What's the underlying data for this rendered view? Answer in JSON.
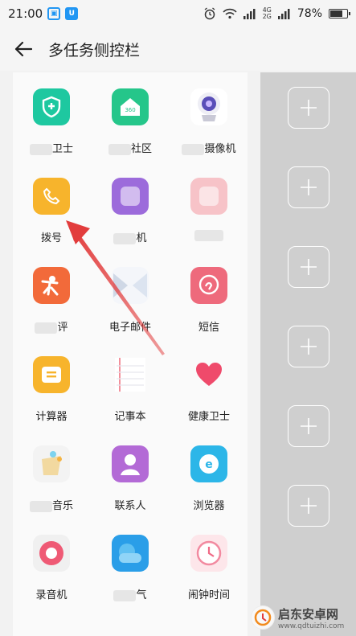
{
  "status_bar": {
    "time": "21:00",
    "net_top": "4G",
    "net_bottom": "2G",
    "battery_text": "78%",
    "battery_level": 0.78
  },
  "header": {
    "title": "多任务侧控栏"
  },
  "apps": [
    {
      "label_parts": [
        "",
        "卫士"
      ],
      "color": "#1ec8a0",
      "icon": "shield-plus-icon"
    },
    {
      "label_parts": [
        "",
        "社区"
      ],
      "color": "#25c68a",
      "icon": "house-360-icon"
    },
    {
      "label_parts": [
        "",
        "摄像机"
      ],
      "color": "#ffffff",
      "icon": "camera-icon"
    },
    {
      "label_parts": [
        "拨号",
        ""
      ],
      "color": "#f7b42c",
      "icon": "phone-icon"
    },
    {
      "label_parts": [
        "",
        "机"
      ],
      "color": "#9c6bdb",
      "icon": "app-icon"
    },
    {
      "label_parts": [
        "",
        ""
      ],
      "color": "#f7c3c8",
      "icon": "app-icon"
    },
    {
      "label_parts": [
        "",
        "评"
      ],
      "color": "#f26a3a",
      "icon": "person-icon"
    },
    {
      "label_parts": [
        "电子邮件",
        ""
      ],
      "color": "#f4f6fa",
      "icon": "mail-icon"
    },
    {
      "label_parts": [
        "短信",
        ""
      ],
      "color": "#ee6a7c",
      "icon": "message-icon"
    },
    {
      "label_parts": [
        "计算器",
        ""
      ],
      "color": "#f7b42c",
      "icon": "calculator-icon"
    },
    {
      "label_parts": [
        "记事本",
        ""
      ],
      "color": "#fafafa",
      "icon": "notepad-icon"
    },
    {
      "label_parts": [
        "健康卫士",
        ""
      ],
      "color": "#fafafa",
      "icon": "heart-icon"
    },
    {
      "label_parts": [
        "",
        "音乐"
      ],
      "color": "#f3f3f3",
      "icon": "music-icon"
    },
    {
      "label_parts": [
        "联系人",
        ""
      ],
      "color": "#b36ad6",
      "icon": "contacts-icon"
    },
    {
      "label_parts": [
        "浏览器",
        ""
      ],
      "color": "#2cb6e8",
      "icon": "browser-icon"
    },
    {
      "label_parts": [
        "录音机",
        ""
      ],
      "color": "#f0f0f0",
      "icon": "recorder-icon"
    },
    {
      "label_parts": [
        "",
        "气"
      ],
      "color": "#2a9ee8",
      "icon": "weather-icon"
    },
    {
      "label_parts": [
        "闹钟时间",
        ""
      ],
      "color": "#fde6ea",
      "icon": "clock-icon"
    }
  ],
  "slots": [
    {
      "icon": "plus-icon"
    },
    {
      "icon": "plus-icon"
    },
    {
      "icon": "plus-icon"
    },
    {
      "icon": "plus-icon"
    },
    {
      "icon": "plus-icon"
    },
    {
      "icon": "plus-icon"
    }
  ],
  "watermark": {
    "title": "启东安卓网",
    "url": "www.qdtuizhi.com"
  },
  "colors": {
    "accent_blue": "#2196f3",
    "arrow_red": "#e23c3c",
    "slot_panel": "#cfcfcf"
  }
}
